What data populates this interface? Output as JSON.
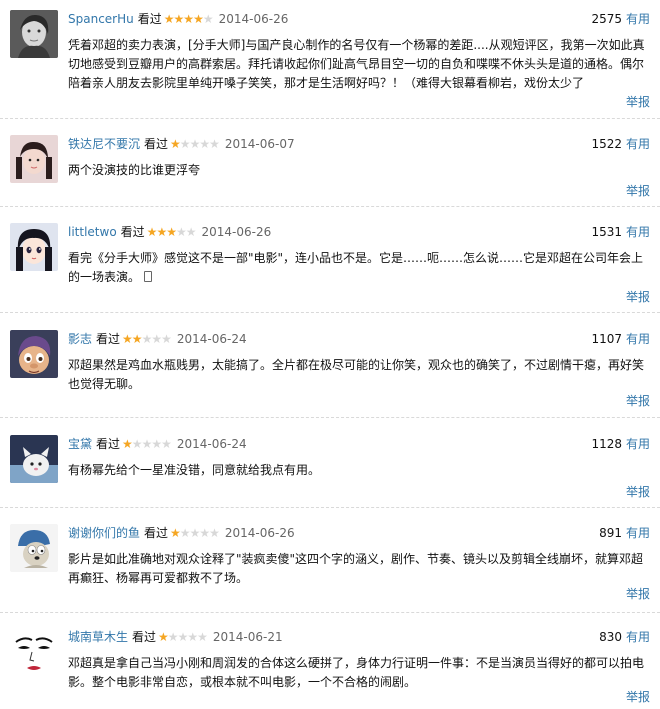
{
  "labels": {
    "watched": "看过",
    "useful": "有用",
    "report": "举报"
  },
  "colors": {
    "link": "#3377aa",
    "star": "#f5a623",
    "star_empty": "#d8d8d8"
  },
  "reviews": [
    {
      "user": "SpancerHu",
      "rating": 4,
      "date": "2014-06-26",
      "votes": "2575",
      "content": "凭着邓超的卖力表演，[分手大师]与国产良心制作的名号仅有一个杨幂的差距....从观短评区，我第一次如此真切地感受到豆瓣用户的高群索居。拜托请收起你们趾高气昂目空一切的自负和喋喋不休头头是道的通格。偶尔陪着亲人朋友去影院里单纯开嗓子笑笑，那才是生活啊好吗？！（难得大银幕看柳岩，戏份太少了",
      "avatar_icon": "woman-portrait-avatar"
    },
    {
      "user": "铁达尼不要沉",
      "rating": 1,
      "date": "2014-06-07",
      "votes": "1522",
      "content": "两个没演技的比谁更浮夸",
      "avatar_icon": "girl-photo-avatar"
    },
    {
      "user": "littletwo",
      "rating": 3,
      "date": "2014-06-26",
      "votes": "1531",
      "content": "看完《分手大师》感觉这不是一部\"电影\"，连小品也不是。它是……呃……怎么说……它是邓超在公司年会上的一场表演。",
      "avatar_icon": "anime-girl-avatar"
    },
    {
      "user": "影志",
      "rating": 2,
      "date": "2014-06-24",
      "votes": "1107",
      "content": "邓超果然是鸡血水瓶贱男，太能搞了。全片都在极尽可能的让你笑，观众也的确笑了，不过剧情干瘪，再好笑也觉得无聊。",
      "avatar_icon": "cartoon-character-avatar"
    },
    {
      "user": "宝黛",
      "rating": 1,
      "date": "2014-06-24",
      "votes": "1128",
      "content": "有杨幂先给个一星准没错，同意就给我点有用。",
      "avatar_icon": "cartoon-cat-avatar"
    },
    {
      "user": "谢谢你们的鱼",
      "rating": 1,
      "date": "2014-06-26",
      "votes": "891",
      "content": "影片是如此准确地对观众诠释了\"装疯卖傻\"这四个字的涵义，剧作、节奏、镜头以及剪辑全线崩坏，就算邓超再癫狂、杨幂再可爱都救不了场。",
      "avatar_icon": "wallace-gromit-avatar"
    },
    {
      "user": "城南草木生",
      "rating": 1,
      "date": "2014-06-21",
      "votes": "830",
      "content": "邓超真是拿自己当冯小刚和周润发的合体这么硬拼了，身体力行证明一件事：不是当演员当得好的都可以拍电影。整个电影非常自恋，或根本就不叫电影，一个不合格的闹剧。",
      "avatar_icon": "ink-face-avatar"
    }
  ]
}
